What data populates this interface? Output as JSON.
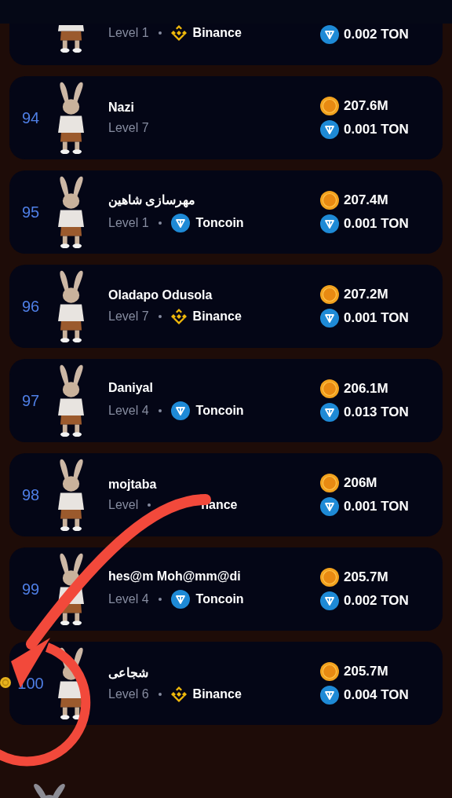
{
  "rows": [
    {
      "rank": null,
      "name": null,
      "level": "Level 1",
      "exchange": {
        "kind": "binance",
        "name": "Binance"
      },
      "coins": null,
      "ton": "0.002 TON",
      "marked": false
    },
    {
      "rank": "94",
      "name": "Nazi",
      "level": "Level 7",
      "exchange": null,
      "coins": "207.6M",
      "ton": "0.001 TON",
      "marked": false
    },
    {
      "rank": "95",
      "name": "مهرسازی شاهین",
      "level": "Level 1",
      "exchange": {
        "kind": "toncoin",
        "name": "Toncoin"
      },
      "coins": "207.4M",
      "ton": "0.001 TON",
      "marked": false
    },
    {
      "rank": "96",
      "name": "Oladapo Odusola",
      "level": "Level 7",
      "exchange": {
        "kind": "binance",
        "name": "Binance"
      },
      "coins": "207.2M",
      "ton": "0.001 TON",
      "marked": false
    },
    {
      "rank": "97",
      "name": "Daniyal",
      "level": "Level 4",
      "exchange": {
        "kind": "toncoin",
        "name": "Toncoin"
      },
      "coins": "206.1M",
      "ton": "0.013 TON",
      "marked": false
    },
    {
      "rank": "98",
      "name": "mojtaba",
      "level": "Level",
      "exchange": {
        "kind": "covered",
        "name": "nance"
      },
      "coins": "206M",
      "ton": "0.001 TON",
      "marked": false
    },
    {
      "rank": "99",
      "name": "hes@m Moh@mm@di",
      "level": "Level 4",
      "exchange": {
        "kind": "toncoin",
        "name": "Toncoin"
      },
      "coins": "205.7M",
      "ton": "0.002 TON",
      "marked": false
    },
    {
      "rank": "100",
      "name": "شجاعی",
      "level": "Level 6",
      "exchange": {
        "kind": "binance",
        "name": "Binance"
      },
      "coins": "205.7M",
      "ton": "0.004 TON",
      "marked": true
    }
  ]
}
